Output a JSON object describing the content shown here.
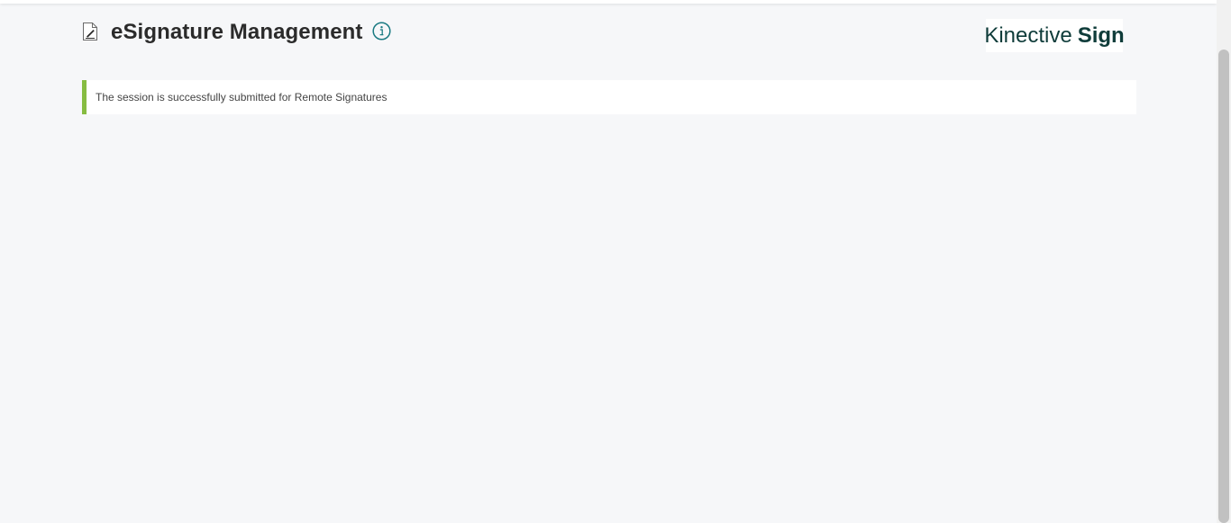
{
  "header": {
    "title": "eSignature Management"
  },
  "brand": {
    "name_regular": "Kinective",
    "name_bold": "Sign"
  },
  "alert": {
    "message": "The session is successfully submitted for Remote Signatures",
    "accent_color": "#86bc41"
  },
  "icons": {
    "document": "document-edit-icon",
    "info": "info-icon"
  },
  "colors": {
    "background": "#f6f7f9",
    "title": "#2b2b2b",
    "info_icon": "#1a7a82",
    "brand": "#0f3c3a"
  }
}
